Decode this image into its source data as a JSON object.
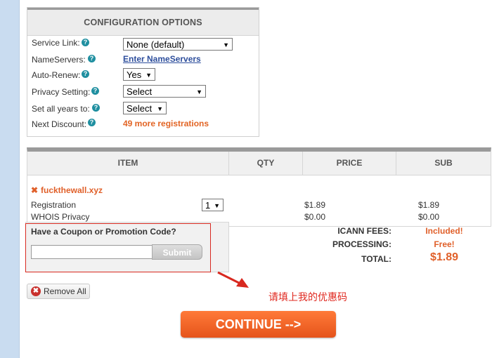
{
  "config": {
    "title": "CONFIGURATION OPTIONS",
    "service_link": {
      "label": "Service Link:",
      "value": "None (default)"
    },
    "nameservers": {
      "label": "NameServers:",
      "link": "Enter NameServers"
    },
    "auto_renew": {
      "label": "Auto-Renew:",
      "value": "Yes"
    },
    "privacy": {
      "label": "Privacy Setting:",
      "value": "Select"
    },
    "years": {
      "label": "Set all years to:",
      "value": "Select"
    },
    "discount": {
      "label": "Next Discount:",
      "value": "49 more registrations"
    },
    "help_glyph": "?"
  },
  "cart": {
    "columns": [
      "ITEM",
      "QTY",
      "PRICE",
      "SUB"
    ],
    "remove_glyph": "✖",
    "domain": "fuckthewall.xyz",
    "rows": [
      {
        "item": "Registration",
        "qty": "1",
        "price": "$1.89",
        "sub": "$1.89"
      },
      {
        "item": "WHOIS Privacy",
        "price": "$0.00",
        "sub": "$0.00"
      }
    ]
  },
  "coupon": {
    "title": "Have a Coupon or Promotion Code?",
    "input_value": "",
    "submit_label": "Submit"
  },
  "totals": {
    "icann_label": "ICANN FEES:",
    "icann_value": "Included!",
    "processing_label": "PROCESSING:",
    "processing_value": "Free!",
    "total_label": "TOTAL:",
    "total_value": "$1.89"
  },
  "actions": {
    "remove_all_label": "Remove All",
    "remove_all_glyph": "✖",
    "continue_label": "CONTINUE -->"
  },
  "annotation": {
    "text": "请填上我的优惠码",
    "color": "#e0281f"
  }
}
